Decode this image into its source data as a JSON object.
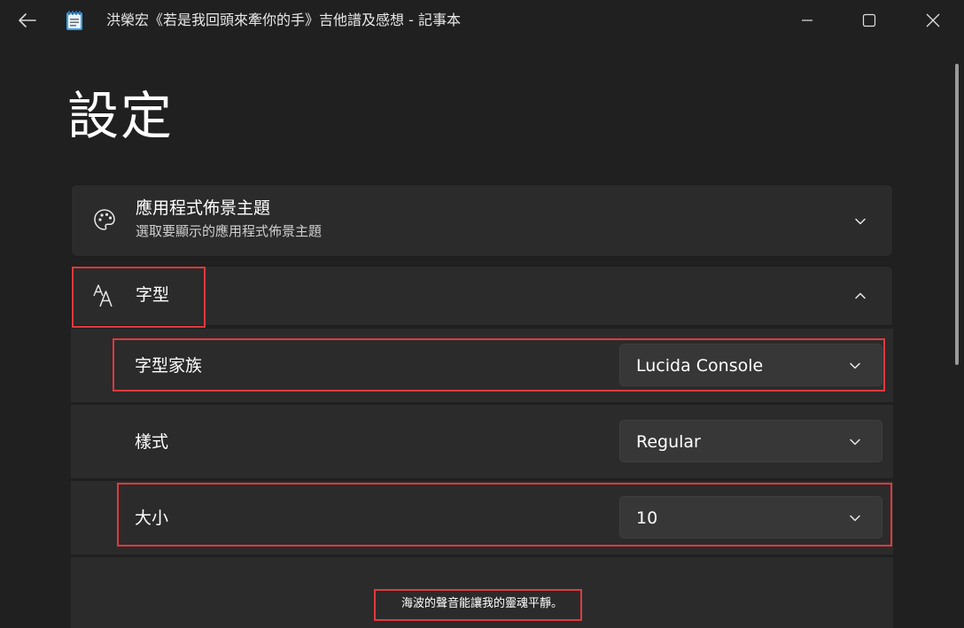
{
  "window": {
    "title": "洪榮宏《若是我回頭來牽你的手》吉他譜及感想 - 記事本",
    "accent_color": "#e0393e"
  },
  "titlebar": {
    "back_icon": "back-arrow-icon",
    "app_icon": "notepad-icon",
    "minimize_icon": "minimize-icon",
    "maximize_icon": "maximize-icon",
    "close_icon": "close-icon"
  },
  "page": {
    "title": "設定"
  },
  "theme_card": {
    "icon": "palette-icon",
    "title": "應用程式佈景主題",
    "subtitle": "選取要顯示的應用程式佈景主題",
    "expanded": false
  },
  "font_card": {
    "icon": "font-icon",
    "title": "字型",
    "expanded": true,
    "rows": [
      {
        "label": "字型家族",
        "value": "Lucida Console"
      },
      {
        "label": "樣式",
        "value": "Regular"
      },
      {
        "label": "大小",
        "value": "10"
      }
    ],
    "preview_text": "海波的聲音能讓我的靈魂平靜。"
  }
}
